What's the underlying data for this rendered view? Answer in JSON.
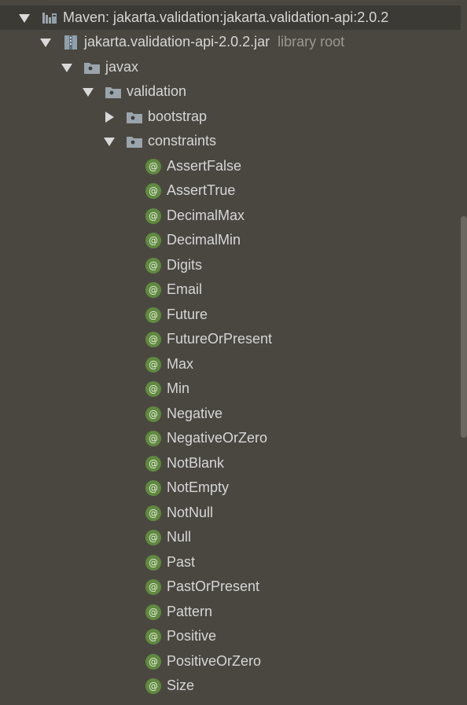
{
  "tree": {
    "maven_root": {
      "label": "Maven: jakarta.validation:jakarta.validation-api:2.0.2"
    },
    "jar": {
      "label": "jakarta.validation-api-2.0.2.jar",
      "suffix": "library root"
    },
    "pkg_javax": {
      "label": "javax"
    },
    "pkg_validation": {
      "label": "validation"
    },
    "pkg_bootstrap": {
      "label": "bootstrap"
    },
    "pkg_constraints": {
      "label": "constraints"
    },
    "annotations": [
      "AssertFalse",
      "AssertTrue",
      "DecimalMax",
      "DecimalMin",
      "Digits",
      "Email",
      "Future",
      "FutureOrPresent",
      "Max",
      "Min",
      "Negative",
      "NegativeOrZero",
      "NotBlank",
      "NotEmpty",
      "NotNull",
      "Null",
      "Past",
      "PastOrPresent",
      "Pattern",
      "Positive",
      "PositiveOrZero",
      "Size"
    ]
  },
  "colors": {
    "background": "#4a4740",
    "text": "#d6d6d6",
    "muted_text": "#9a9891",
    "annotation_icon": "#5f8a3f",
    "folder_icon": "#9aa4ab"
  }
}
